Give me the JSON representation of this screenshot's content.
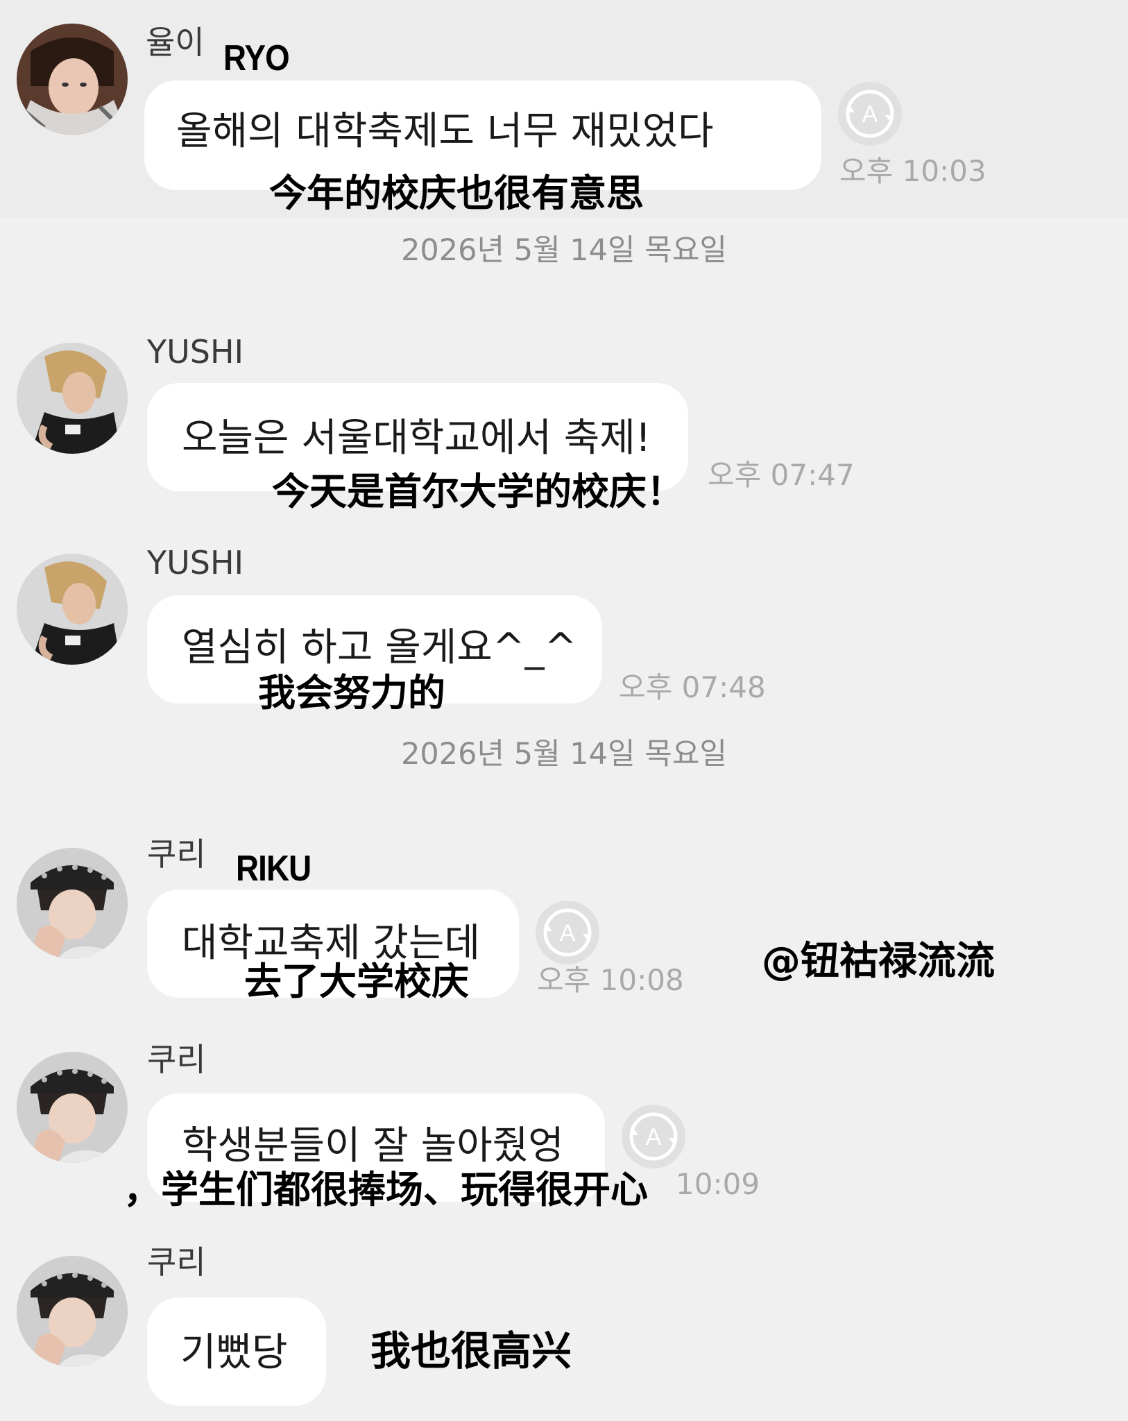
{
  "messages": [
    {
      "sender": "율이",
      "sender_overlay": "RYO",
      "text": "올해의 대학축제도 너무 재밌었다",
      "translation": "今年的校庆也很有意思",
      "time": "오후 10:03"
    },
    {
      "sender": "YUSHI",
      "text": "오늘은 서울대학교에서 축제!",
      "translation": "今天是首尔大学的校庆！",
      "time": "오후 07:47"
    },
    {
      "sender": "YUSHI",
      "text": "열심히 하고 올게요^_^",
      "translation": "我会努力的",
      "time": "오후 07:48"
    },
    {
      "sender": "쿠리",
      "sender_overlay": "RIKU",
      "text": "대학교축제 갔는데",
      "translation": "去了大学校庆",
      "time": "오후 10:08"
    },
    {
      "sender": "쿠리",
      "text": "학생분들이 잘 놀아줬엉",
      "translation": "，学生们都很捧场、玩得很开心",
      "time": "10:09"
    },
    {
      "sender": "쿠리",
      "text": "기뻤당",
      "translation": "我也很高兴"
    }
  ],
  "date_separators": [
    "2026년 5월 14일 목요일",
    "2026년 5월 14일 목요일"
  ],
  "watermark": "@钮祜禄流流",
  "icons": {
    "translate": "translate-icon",
    "avatar": "avatar-photo"
  },
  "colors": {
    "background": "#efefef",
    "bubble": "#ffffff",
    "timestamp": "#a9a9a9",
    "date_text": "#8d8d8d"
  }
}
